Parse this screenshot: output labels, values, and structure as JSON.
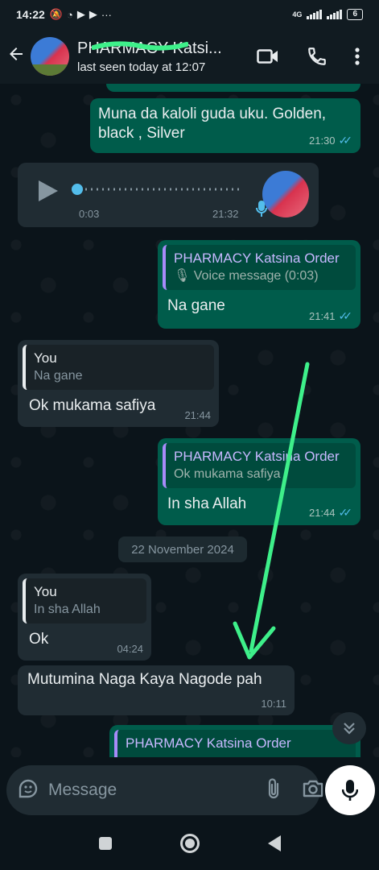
{
  "status_bar": {
    "time": "14:22",
    "network": "4G",
    "battery": "6"
  },
  "header": {
    "contact_name": "PHARMACY Katsi...",
    "last_seen": "last seen today at 12:07"
  },
  "messages": [
    {
      "direction": "out",
      "text": "Muna da kaloli guda uku. Golden, black , Silver",
      "time": "21:30",
      "ticks": "✓✓"
    },
    {
      "direction": "in",
      "type": "voice",
      "elapsed": "0:03",
      "time": "21:32"
    },
    {
      "direction": "out",
      "quote_author": "PHARMACY Katsina Order",
      "quote_text": "Voice message (0:03)",
      "text": "Na gane",
      "time": "21:41",
      "ticks": "✓✓"
    },
    {
      "direction": "in",
      "quote_author": "You",
      "quote_text": "Na gane",
      "text": "Ok mukama safiya",
      "time": "21:44"
    },
    {
      "direction": "out",
      "quote_author": "PHARMACY Katsina Order",
      "quote_text": "Ok mukama safiya",
      "text": "In sha Allah",
      "time": "21:44",
      "ticks": "✓✓"
    },
    {
      "direction": "in",
      "quote_author": "You",
      "quote_text": "In sha Allah",
      "text": "Ok",
      "time": "04:24"
    },
    {
      "direction": "in",
      "text": "Mutumina Naga Kaya Nagode pah",
      "time": "10:11"
    },
    {
      "direction": "out",
      "quote_author": "PHARMACY Katsina Order"
    }
  ],
  "date_divider": "22 November 2024",
  "composer": {
    "placeholder": "Message"
  },
  "colors": {
    "outgoing_bubble": "#005c4b",
    "incoming_bubble": "#202c33",
    "background": "#0b141a",
    "read_ticks": "#53bdeb",
    "annotation_arrow": "#3ef08a"
  },
  "icons": [
    "back-arrow-icon",
    "video-call-icon",
    "phone-icon",
    "more-options-icon",
    "play-icon",
    "mic-icon",
    "sticker-icon",
    "attach-icon",
    "camera-icon",
    "chevron-double-down-icon"
  ]
}
